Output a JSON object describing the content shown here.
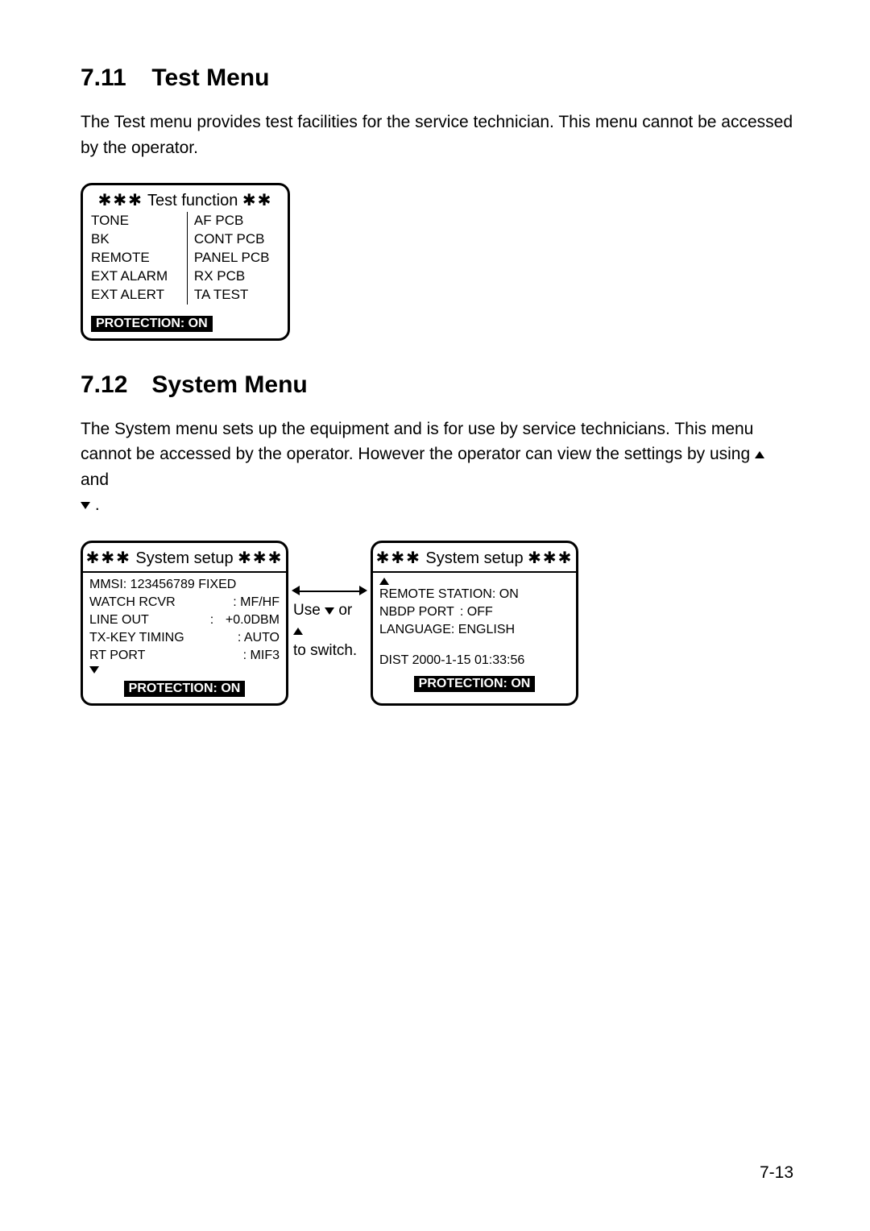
{
  "section1": {
    "number": "7.11",
    "title": "Test Menu",
    "paragraph": "The Test menu provides test facilities for the service technician. This menu cannot be accessed by the operator."
  },
  "test_panel": {
    "stars_left": "✱✱✱",
    "title": "Test function",
    "stars_right": "✱✱",
    "col1": [
      "TONE",
      "BK",
      "REMOTE",
      "EXT ALARM",
      "EXT ALERT"
    ],
    "col2": [
      "AF PCB",
      "CONT PCB",
      "PANEL PCB",
      "RX PCB",
      "TA TEST"
    ],
    "protection": "PROTECTION: ON"
  },
  "section2": {
    "number": "7.12",
    "title": "System Menu",
    "paragraph_a": "The System menu sets up the equipment and is for use by service technicians. This menu cannot be accessed by the operator. However the operator can view the settings by using ",
    "paragraph_b": " and ",
    "paragraph_c": " ."
  },
  "sys_panel_left": {
    "stars": "✱✱✱",
    "title": "System setup",
    "rows": [
      {
        "k": "MMSI: 123456789 FIXED",
        "v": ""
      },
      {
        "k": "WATCH RCVR",
        "v": ": MF/HF"
      },
      {
        "k": "LINE OUT",
        "colon": ":",
        "v": "+0.0DBM"
      },
      {
        "k": "TX-KEY TIMING",
        "v": ": AUTO"
      },
      {
        "k": "RT PORT",
        "v": ": MIF3"
      }
    ],
    "protection": "PROTECTION: ON"
  },
  "connector": {
    "line1": "Use ",
    "line1b": " or ",
    "line2": "to switch."
  },
  "sys_panel_right": {
    "stars": "✱✱✱",
    "title": "System setup",
    "rows": [
      {
        "k": "REMOTE STATION: ON",
        "v": ""
      },
      {
        "k": "NBDP PORT",
        "v": ": OFF"
      },
      {
        "k": "LANGUAGE: ENGLISH",
        "v": ""
      }
    ],
    "footer_line": "DIST 2000-1-15 01:33:56",
    "protection": "PROTECTION: ON"
  },
  "page_number": "7-13"
}
